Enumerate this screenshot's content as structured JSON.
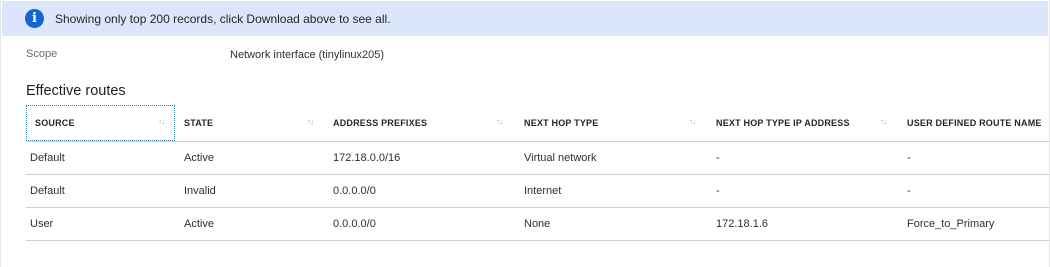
{
  "banner": {
    "icon": "info-icon",
    "text": "Showing only top 200 records, click Download above to see all."
  },
  "scope": {
    "label": "Scope",
    "value": "Network interface (tinylinux205)"
  },
  "section_title": "Effective routes",
  "table": {
    "columns": [
      {
        "label": "SOURCE",
        "sortable": true,
        "focused": true
      },
      {
        "label": "STATE",
        "sortable": true
      },
      {
        "label": "ADDRESS PREFIXES",
        "sortable": true
      },
      {
        "label": "NEXT HOP TYPE",
        "sortable": true
      },
      {
        "label": "NEXT HOP TYPE IP ADDRESS",
        "sortable": true
      },
      {
        "label": "USER DEFINED ROUTE NAME",
        "sortable": false
      }
    ],
    "sort_glyph": "↑↓",
    "rows": [
      [
        "Default",
        "Active",
        "172.18.0.0/16",
        "Virtual network",
        "-",
        "-"
      ],
      [
        "Default",
        "Invalid",
        "0.0.0.0/0",
        "Internet",
        "-",
        "-"
      ],
      [
        "User",
        "Active",
        "0.0.0.0/0",
        "None",
        "172.18.1.6",
        "Force_to_Primary"
      ]
    ]
  }
}
